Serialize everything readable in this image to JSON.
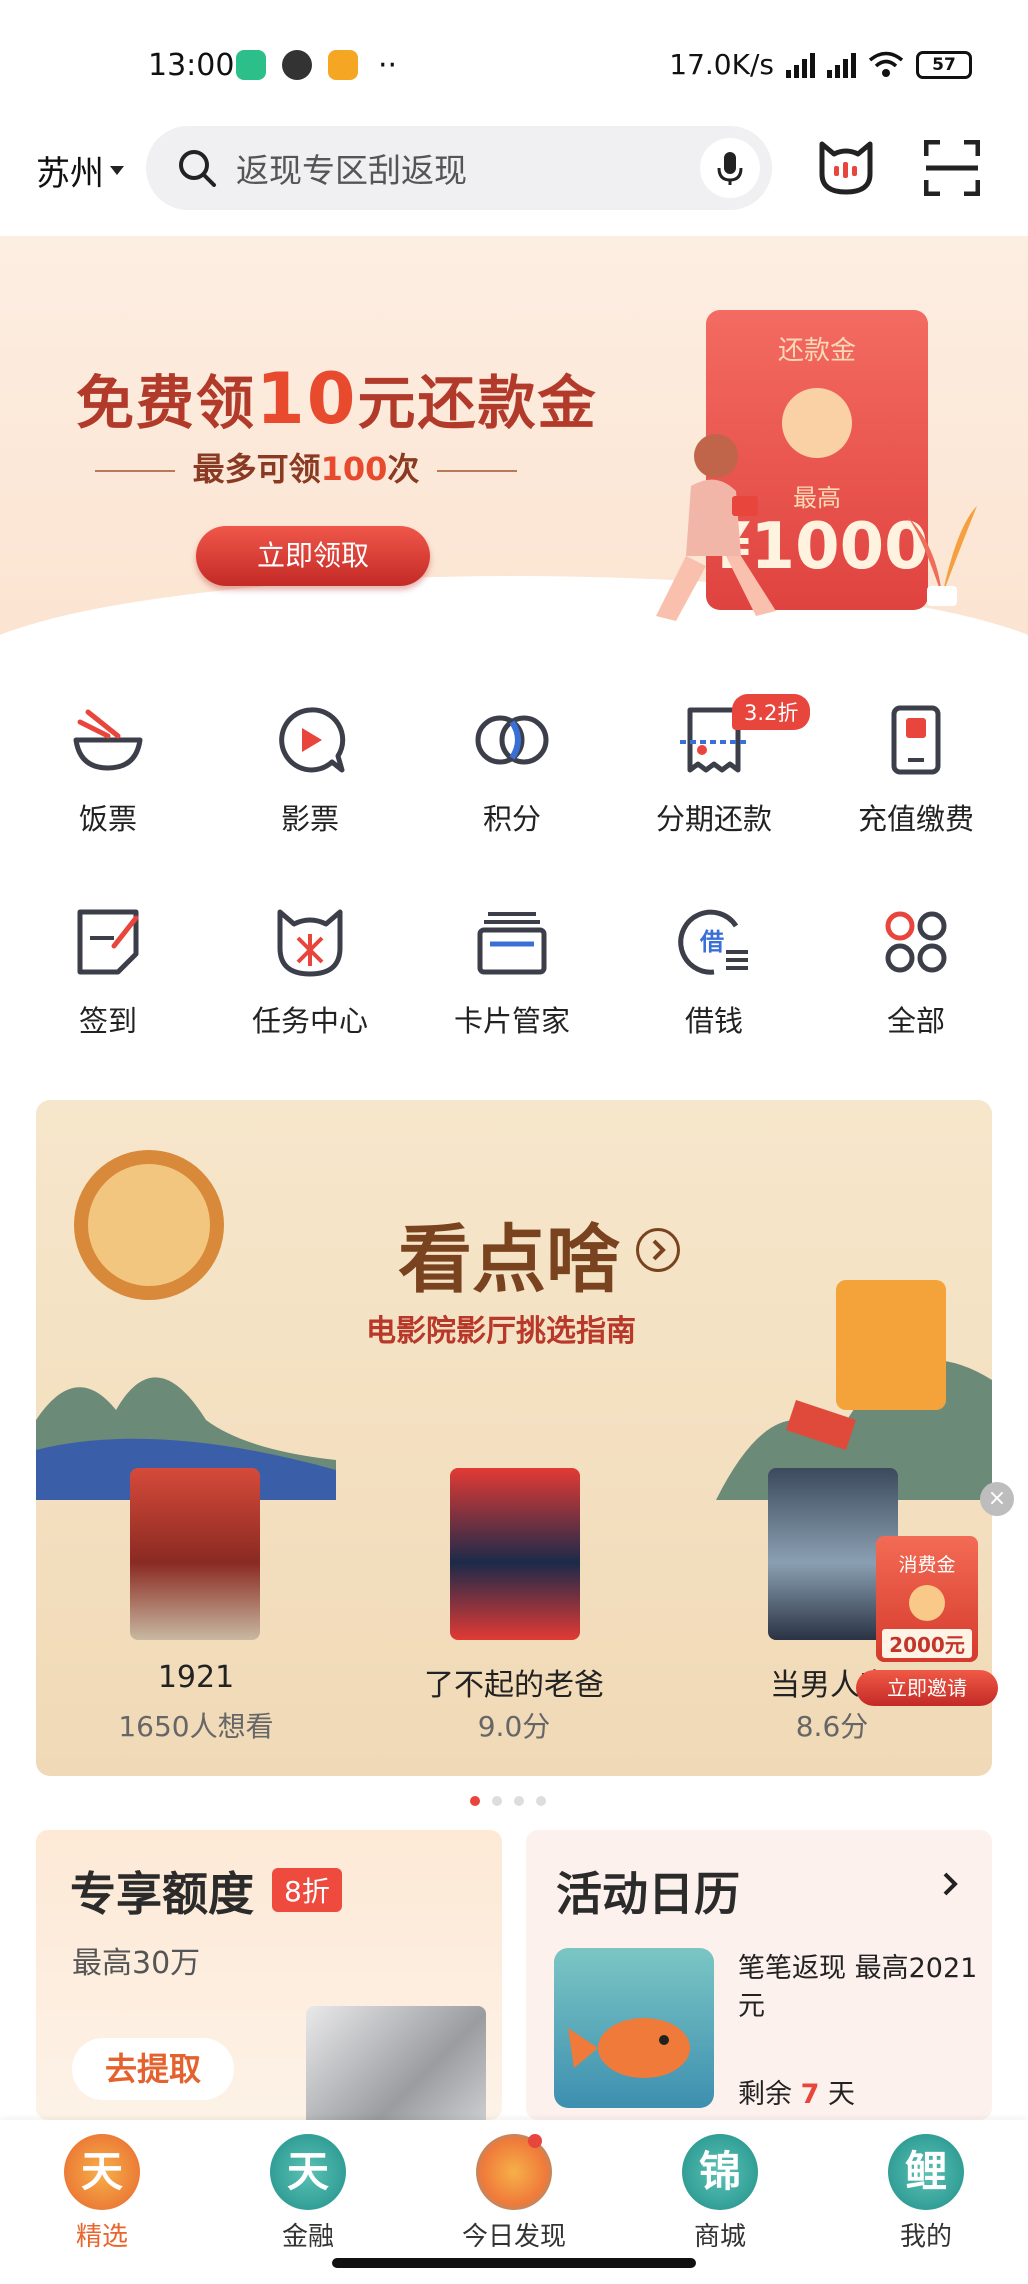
{
  "status_bar": {
    "time": "13:00",
    "net_speed": "17.0K/s",
    "battery": "57",
    "more": "··"
  },
  "header": {
    "city": "苏州",
    "search_placeholder": "返现专区刮返现"
  },
  "banner": {
    "title_pre": "免费领",
    "title_num": "10",
    "title_post": "元还款金",
    "sub_pre": "最多可领",
    "sub_num": "100",
    "sub_post": "次",
    "button": "立即领取",
    "envelope_title": "还款金",
    "envelope_max": "最高",
    "envelope_amount": "¥1000"
  },
  "grid": {
    "row1": [
      "饭票",
      "影票",
      "积分",
      "分期还款",
      "充值缴费"
    ],
    "row2": [
      "签到",
      "任务中心",
      "卡片管家",
      "借钱",
      "全部"
    ],
    "badge": "3.2折"
  },
  "movie": {
    "title": "看点啥",
    "subtitle": "电影院影厅挑选指南",
    "items": [
      {
        "name": "1921",
        "meta": "1650人想看"
      },
      {
        "name": "了不起的老爸",
        "meta": "9.0分"
      },
      {
        "name": "当男人恋",
        "meta": "8.6分"
      }
    ]
  },
  "float_ad": {
    "title": "消费金",
    "amount": "2000元",
    "button": "立即邀请",
    "close": "×"
  },
  "card_quota": {
    "title": "专享额度",
    "badge": "8折",
    "sub": "最高30万",
    "button": "去提取"
  },
  "card_calendar": {
    "title": "活动日历",
    "desc": "笔笔返现 最高2021元",
    "remain_pre": "剩余",
    "remain_num": "7",
    "remain_post": "天"
  },
  "tabs": [
    {
      "icon": "天",
      "label": "精选"
    },
    {
      "icon": "天",
      "label": "金融"
    },
    {
      "icon": "",
      "label": "今日发现"
    },
    {
      "icon": "锦",
      "label": "商城"
    },
    {
      "icon": "鲤",
      "label": "我的"
    }
  ],
  "colors": {
    "accent": "#e8453c",
    "brand_orange": "#e8662e"
  }
}
